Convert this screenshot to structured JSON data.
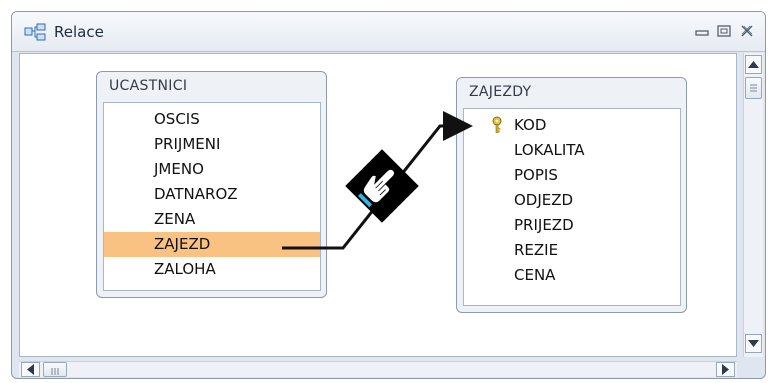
{
  "window": {
    "title": "Relace",
    "icon": "relationships-icon",
    "controls": [
      "minimize-icon",
      "restore-icon",
      "close-icon"
    ]
  },
  "tables": [
    {
      "name": "UCASTNICI",
      "fields": [
        "OSCIS",
        "PRIJMENI",
        "JMENO",
        "DATNAROZ",
        "ZENA",
        "ZAJEZD",
        "ZALOHA"
      ],
      "selected_field": "ZAJEZD"
    },
    {
      "name": "ZAJEZDY",
      "fields": [
        "KOD",
        "LOKALITA",
        "POPIS",
        "ODJEZD",
        "PRIJEZD",
        "REZIE",
        "CENA"
      ],
      "primary_key": "KOD"
    }
  ],
  "relationship": {
    "from": "UCASTNICI.ZAJEZD",
    "to": "ZAJEZDY.KOD",
    "cursor_icon": "drag-hand-icon",
    "colors": {
      "line": "#111111",
      "selection": "#f9c283"
    }
  },
  "scrollbars": {
    "vertical": [
      "scroll-up-icon",
      "scroll-down-icon"
    ],
    "horizontal": [
      "scroll-left-icon",
      "scroll-right-icon"
    ]
  }
}
